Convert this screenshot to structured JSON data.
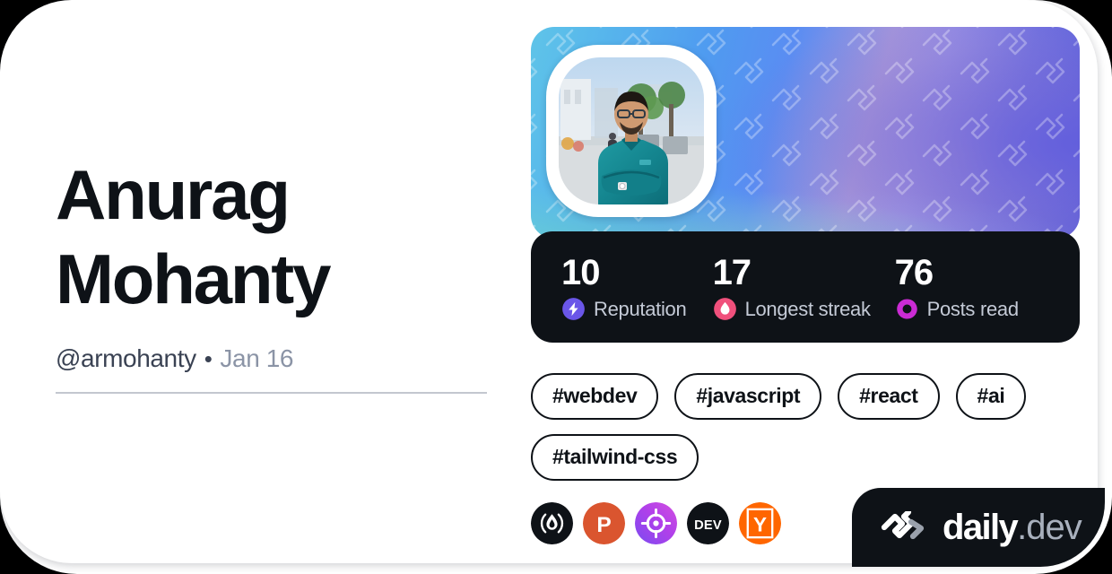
{
  "profile": {
    "name": "Anurag Mohanty",
    "handle": "@armohanty",
    "separator": "•",
    "date": "Jan 16",
    "avatar_alt": "profile-photo"
  },
  "stats": [
    {
      "value": "10",
      "label": "Reputation",
      "icon": "bolt-icon",
      "icon_color": "#6a56e8"
    },
    {
      "value": "17",
      "label": "Longest streak",
      "icon": "flame-icon",
      "icon_color": "#f0507c"
    },
    {
      "value": "76",
      "label": "Posts read",
      "icon": "ring-icon",
      "icon_color": "#cb2bd4"
    }
  ],
  "tags": [
    {
      "label": "#webdev"
    },
    {
      "label": "#javascript"
    },
    {
      "label": "#react"
    },
    {
      "label": "#ai"
    },
    {
      "label": "#tailwind-css"
    }
  ],
  "sources": [
    {
      "name": "hashnode-icon",
      "bg": "#0e1217",
      "fg": "#ffffff"
    },
    {
      "name": "producthunt-icon",
      "bg": "#da552f",
      "fg": "#ffffff",
      "letter": "P"
    },
    {
      "name": "target-icon",
      "bg": "#b341e8",
      "fg": "#ffffff"
    },
    {
      "name": "devto-icon",
      "bg": "#0e1217",
      "fg": "#ffffff",
      "letter": "DEV"
    },
    {
      "name": "hackernews-icon",
      "bg": "#ff6600",
      "fg": "#ffffff",
      "letter": "Y"
    }
  ],
  "brand": {
    "name": "daily",
    "suffix": ".dev",
    "logo": "daily-dev-logo-icon",
    "bg": "#0e1217"
  },
  "theme": {
    "page_bg": "#000000",
    "card_bg": "#ffffff",
    "text_primary": "#0e1217",
    "text_secondary": "#3a4253",
    "text_muted": "#8b94a6",
    "dark_panel": "#0e1217",
    "divider": "#c3c7cf"
  }
}
